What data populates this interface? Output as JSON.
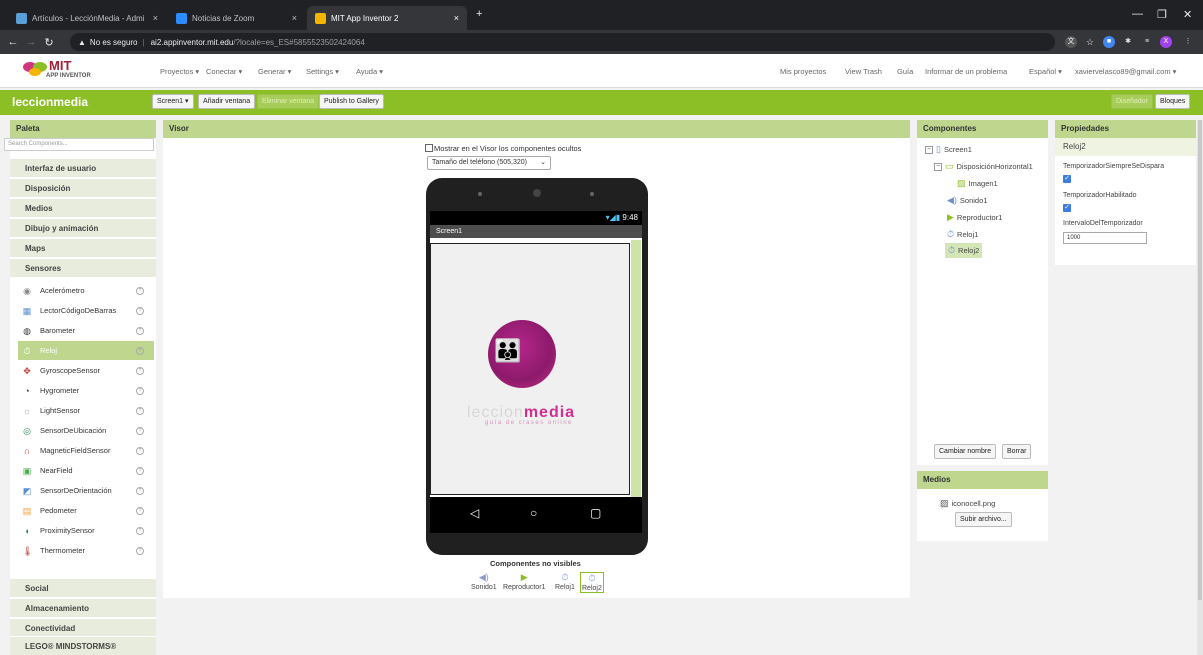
{
  "browser": {
    "tabs": [
      {
        "title": "Artículos - LecciónMedia - Admi",
        "active": false
      },
      {
        "title": "Noticias de Zoom",
        "active": false
      },
      {
        "title": "MIT App Inventor 2",
        "active": true
      }
    ],
    "new_tab": "+",
    "security_label": "No es seguro",
    "url_host": "ai2.appinventor.mit.edu",
    "url_rest": "/?locale=es_ES#5855523502424064",
    "profile_initial": "X"
  },
  "header": {
    "logo_text": "MIT",
    "logo_sub": "APP INVENTOR",
    "menus": [
      "Proyectos ▾",
      "Conectar ▾",
      "Generar ▾",
      "Settings ▾",
      "Ayuda ▾"
    ],
    "right_links": [
      "Mis proyectos",
      "View Trash",
      "Guía",
      "Informar de un problema",
      "Español ▾",
      "xaviervelasco89@gmail.com ▾"
    ]
  },
  "toolbar": {
    "project_name": "leccionmedia",
    "screen_button": "Screen1 ▾",
    "add_window": "Añadir ventana",
    "remove_window": "Eliminar ventana",
    "publish": "Publish to Gallery",
    "designer": "Diseñador",
    "blocks": "Bloques"
  },
  "palette": {
    "title": "Paleta",
    "search_placeholder": "Search Components...",
    "categories_top": [
      "Interfaz de usuario",
      "Disposición",
      "Medios",
      "Dibujo y animación",
      "Maps",
      "Sensores"
    ],
    "sensors": [
      "Acelerómetro",
      "LectorCódigoDeBarras",
      "Barometer",
      "Reloj",
      "GyroscopeSensor",
      "Hygrometer",
      "LightSensor",
      "SensorDeUbicación",
      "MagneticFieldSensor",
      "NearField",
      "SensorDeOrientación",
      "Pedometer",
      "ProximitySensor",
      "Thermometer"
    ],
    "selected_sensor": "Reloj",
    "categories_bottom": [
      "Social",
      "Almacenamiento",
      "Conectividad",
      "LEGO® MINDSTORMS®"
    ]
  },
  "viewer": {
    "title": "Visor",
    "show_hidden_label": "Mostrar en el Visor los componentes ocultos",
    "size_select": "Tamaño del teléfono (505,320)",
    "status_time": "9:48",
    "screen_title": "Screen1",
    "app_logo_light": "leccion",
    "app_logo_bold": "media",
    "app_logo_sub": "guía de clases online",
    "nonvisible_title": "Componentes no visibles",
    "nonvisible": [
      "Sonido1",
      "Reproductor1",
      "Reloj1",
      "Reloj2"
    ],
    "nonvisible_selected": "Reloj2"
  },
  "components": {
    "title": "Componentes",
    "tree": [
      "Screen1",
      "DisposiciónHorizontal1",
      "Imagen1",
      "Sonido1",
      "Reproductor1",
      "Reloj1",
      "Reloj2"
    ],
    "selected": "Reloj2",
    "rename": "Cambiar nombre",
    "delete": "Borrar"
  },
  "media": {
    "title": "Medios",
    "file": "iconocell.png",
    "upload": "Subir archivo..."
  },
  "properties": {
    "title": "Propiedades",
    "component": "Reloj2",
    "prop1": "TemporizadorSiempreSeDispara",
    "prop2": "TemporizadorHabilitado",
    "prop3": "IntervaloDelTemporizador",
    "interval_value": "1000"
  },
  "colors": {
    "green_bar": "#8cbf26",
    "panel_header": "#bfd68f",
    "brand_pink": "#d02f8e"
  }
}
